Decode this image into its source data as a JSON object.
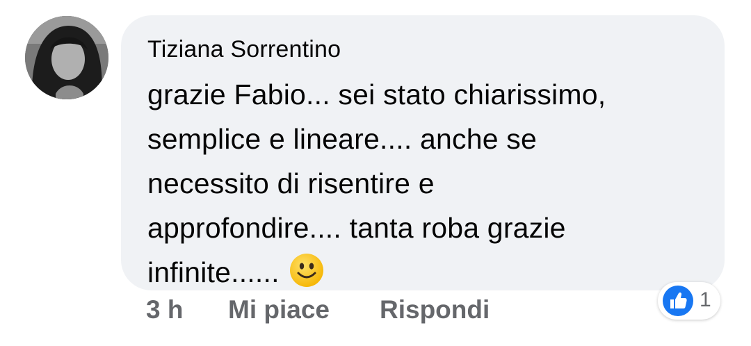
{
  "comment": {
    "author": "Tiziana Sorrentino",
    "lines": [
      "grazie Fabio... sei stato chiarissimo,",
      "semplice e lineare.... anche se",
      "necessito di risentire e",
      "approfondire.... tanta roba   grazie",
      "infinite......"
    ],
    "emoji": "slightly-smiling-face",
    "time": "3 h",
    "like_label": "Mi piace",
    "reply_label": "Rispondi",
    "reaction": {
      "icon": "thumbs-up-icon",
      "count": "1",
      "color": "#1877f2"
    }
  },
  "colors": {
    "bubble": "#f0f2f5",
    "text": "#050505",
    "secondary": "#65676b"
  }
}
